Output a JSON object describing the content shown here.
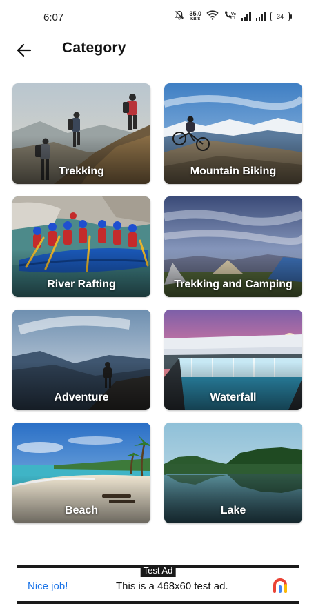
{
  "status_bar": {
    "time": "6:07",
    "net_speed_value": "35.0",
    "net_speed_unit": "KB/S",
    "battery": "34"
  },
  "app_bar": {
    "title": "Category"
  },
  "categories": [
    {
      "label": "Trekking"
    },
    {
      "label": "Mountain Biking"
    },
    {
      "label": "River Rafting"
    },
    {
      "label": "Trekking and Camping"
    },
    {
      "label": "Adventure"
    },
    {
      "label": "Waterfall"
    },
    {
      "label": "Beach"
    },
    {
      "label": "Lake"
    }
  ],
  "ad": {
    "tag": "Test Ad",
    "headline": "Nice job!",
    "body": "This is a 468x60 test ad."
  },
  "colors": {
    "ad_headline": "#1a73e8",
    "ad_frame": "#1a1a1a"
  }
}
